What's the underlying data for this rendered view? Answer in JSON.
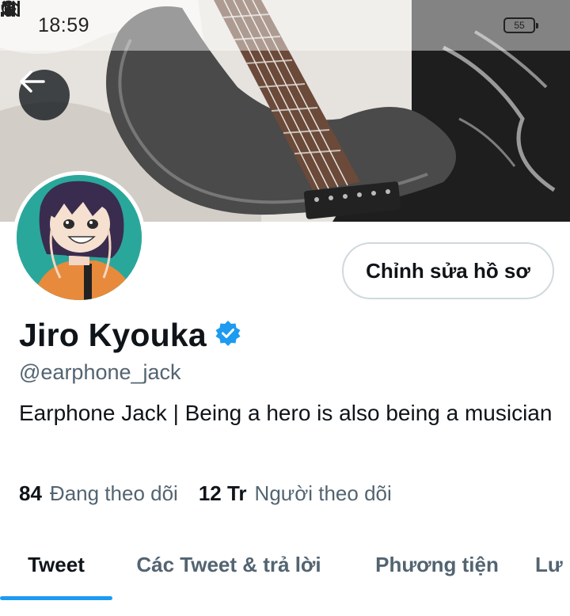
{
  "status_bar": {
    "time": "18:59",
    "battery": "55",
    "icons": [
      "moon-icon",
      "alarm-icon",
      "mute-icon",
      "wifi-icon",
      "signal-icon",
      "battery-icon"
    ]
  },
  "profile": {
    "name": "Jiro Kyouka",
    "verified": true,
    "handle": "@earphone_jack",
    "bio": "Earphone Jack | Being a hero is also being a musician",
    "edit_button_label": "Chỉnh sửa hồ sơ"
  },
  "stats": {
    "following_count": "84",
    "following_label": "Đang theo dõi",
    "followers_count": "12 Tr",
    "followers_label": "Người theo dõi"
  },
  "tabs": [
    {
      "label": "Tweet",
      "active": true
    },
    {
      "label": "Các Tweet & trả lời",
      "active": false
    },
    {
      "label": "Phương tiện",
      "active": false
    },
    {
      "label": "Lư",
      "active": false
    }
  ],
  "colors": {
    "accent": "#1d9bf0",
    "text_primary": "#0f1419",
    "text_secondary": "#536471",
    "border": "#cfd9de"
  }
}
